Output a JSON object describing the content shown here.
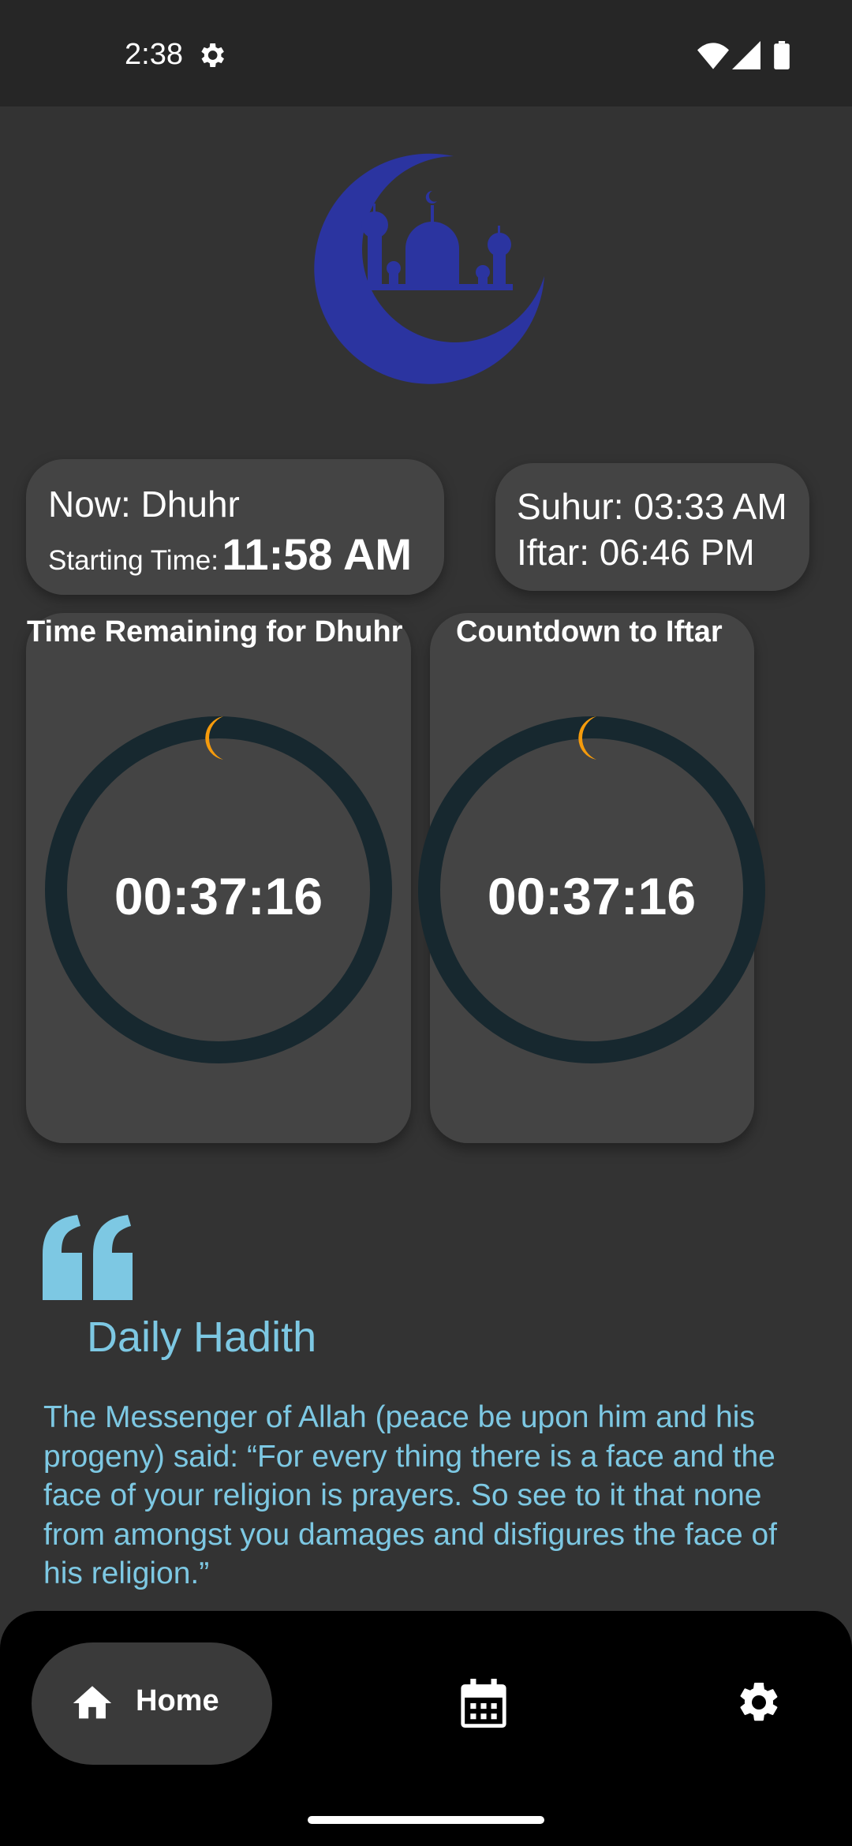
{
  "status_bar": {
    "time": "2:38"
  },
  "now_card": {
    "now_label": "Now: Dhuhr",
    "starting_label": "Starting Time:",
    "starting_time": "11:58 AM"
  },
  "times_card": {
    "suhur": "Suhur: 03:33 AM",
    "iftar": "Iftar: 06:46 PM"
  },
  "timers": [
    {
      "title": "Time Remaining for Dhuhr",
      "value": "00:37:16"
    },
    {
      "title": "Countdown to Iftar",
      "value": "00:37:16"
    }
  ],
  "hadith": {
    "title": "Daily Hadith",
    "text": "The Messenger of Allah (peace be upon him and his progeny) said: “For every thing there is a face and the face of your religion is prayers. So see to it that none from amongst you damages and disfigures the face of his religion.”"
  },
  "nav": {
    "home_label": "Home",
    "items": [
      "home-icon",
      "calendar-icon",
      "settings-icon"
    ]
  },
  "colors": {
    "background": "#333333",
    "card": "#444444",
    "ring": "#17282f",
    "ring_indicator": "#f59b0c",
    "logo": "#2b34a0",
    "accent": "#7dc8e3"
  }
}
